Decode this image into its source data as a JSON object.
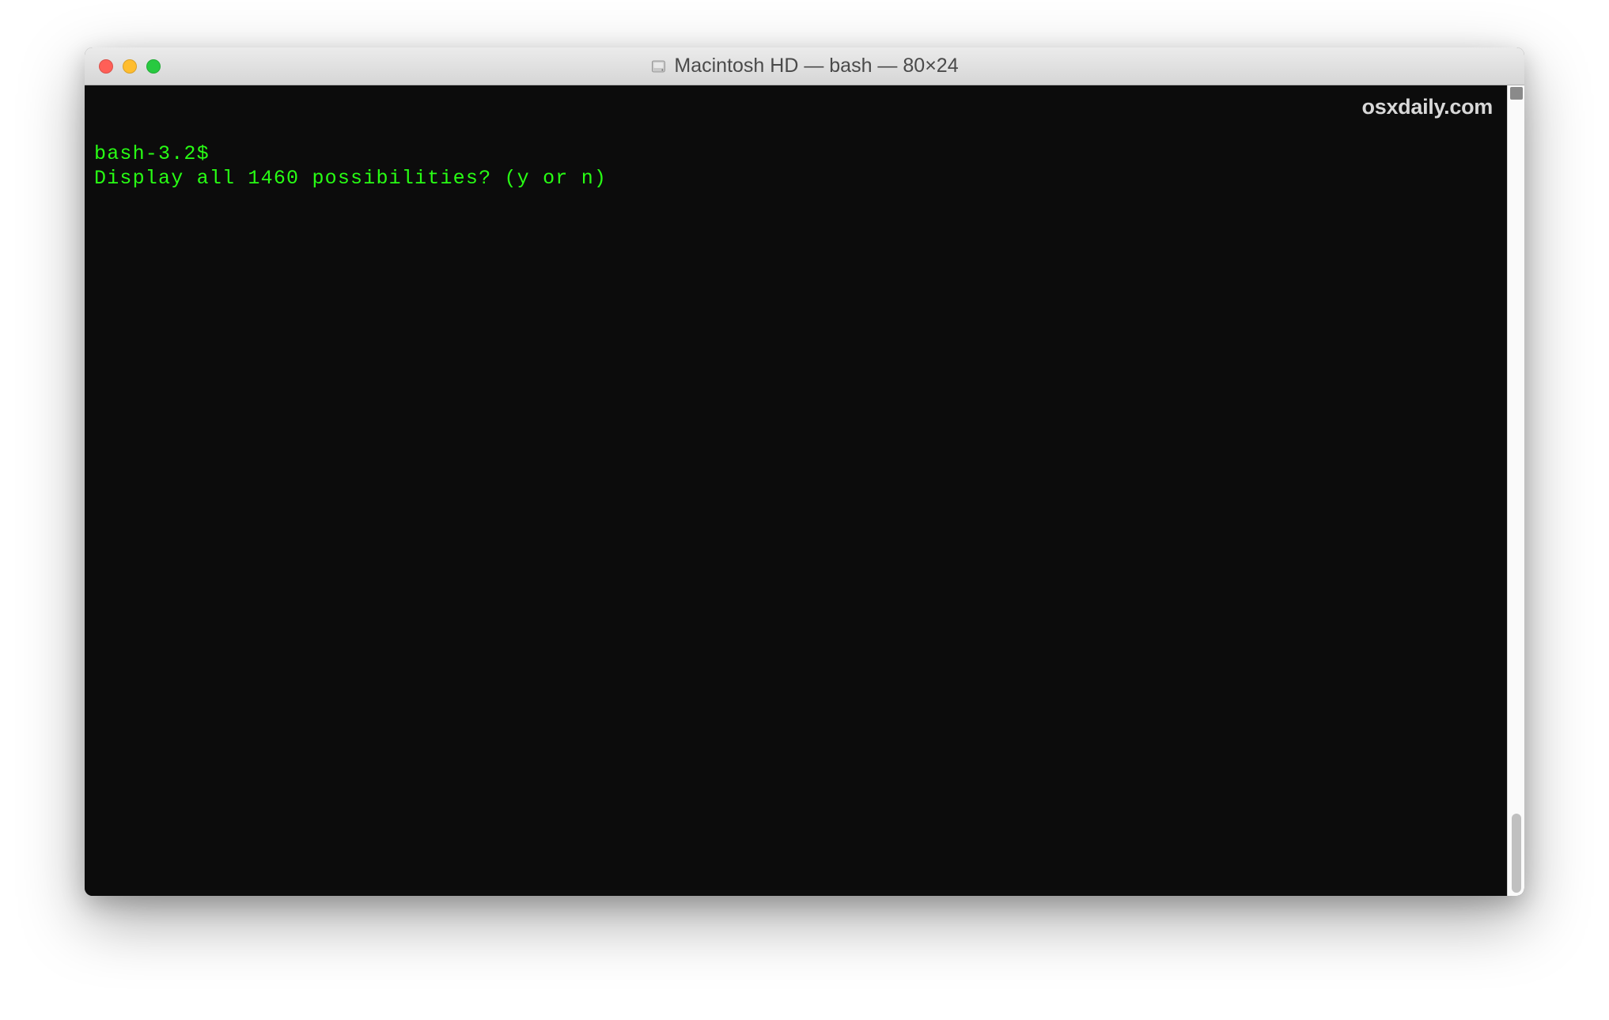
{
  "window": {
    "title": "Macintosh HD — bash — 80×24",
    "disk_icon_name": "disk-icon"
  },
  "traffic_lights": {
    "close": {
      "color": "#ff5f57"
    },
    "minimize": {
      "color": "#ffbd2e"
    },
    "zoom": {
      "color": "#28c940"
    }
  },
  "terminal": {
    "prompt": "bash-3.2$ ",
    "line2": "Display all 1460 possibilities? (y or n)",
    "text_color": "#28fe14",
    "background_color": "#0c0c0c"
  },
  "watermark": "osxdaily.com"
}
